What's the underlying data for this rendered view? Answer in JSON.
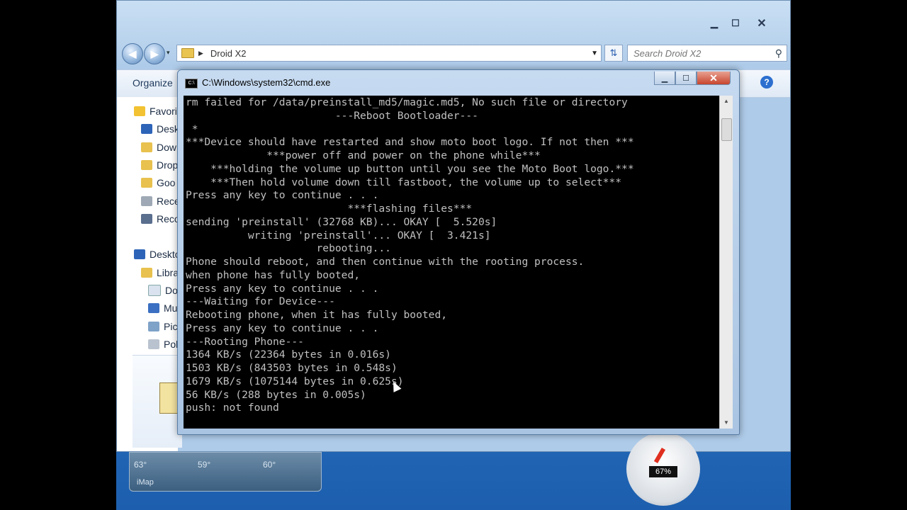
{
  "explorer": {
    "address_path": "Droid X2",
    "search_placeholder": "Search Droid X2",
    "toolbar_organize": "Organize",
    "nav_items": [
      "Favori",
      "Desk",
      "Dow",
      "Drop",
      "Goo",
      "Rece",
      "Reco",
      "Deskto",
      "Libra",
      "Do",
      "Mu",
      "Pic",
      "Pol"
    ]
  },
  "gadgets": {
    "weather_temps": [
      "63°",
      "59°",
      "60°"
    ],
    "weather_location": "iMap",
    "meter_value": "67%"
  },
  "cmd": {
    "title": "C:\\Windows\\system32\\cmd.exe",
    "title_icon": "C:\\",
    "lines": [
      "rm failed for /data/preinstall_md5/magic.md5, No such file or directory",
      "                        ---Reboot Bootloader---",
      " *",
      "***Device should have restarted and show moto boot logo. If not then ***",
      "             ***power off and power on the phone while***",
      "    ***holding the volume up button until you see the Moto Boot logo.***",
      "    ***Then hold volume down till fastboot, the volume up to select***",
      "Press any key to continue . . .",
      "                          ***flashing files***",
      "sending 'preinstall' (32768 KB)... OKAY [  5.520s]",
      "          writing 'preinstall'... OKAY [  3.421s]",
      "                     rebooting...",
      "Phone should reboot, and then continue with the rooting process.",
      "when phone has fully booted,",
      "Press any key to continue . . .",
      "---Waiting for Device---",
      "Rebooting phone, when it has fully booted,",
      "Press any key to continue . . .",
      "---Rooting Phone---",
      "1364 KB/s (22364 bytes in 0.016s)",
      "1503 KB/s (843503 bytes in 0.548s)",
      "1679 KB/s (1075144 bytes in 0.625s)",
      "56 KB/s (288 bytes in 0.005s)",
      "push: not found"
    ]
  }
}
